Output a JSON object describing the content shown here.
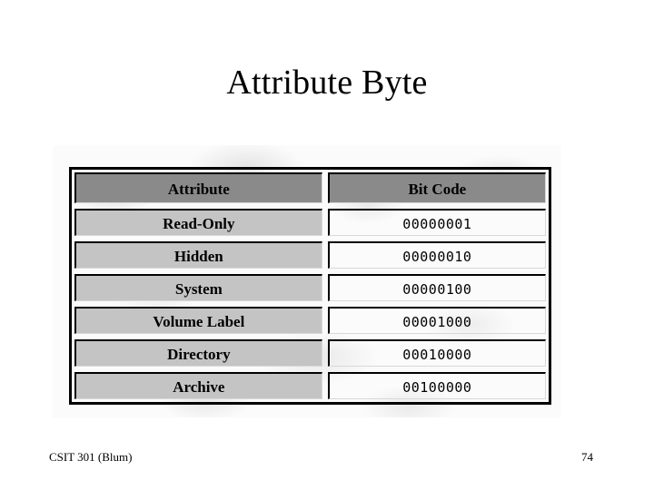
{
  "slide": {
    "title": "Attribute Byte",
    "page_number": "74",
    "course_footer": "CSIT 301 (Blum)"
  },
  "colors": {
    "header_cell": "#8a8a8a",
    "attribute_cell": "#c4c4c4",
    "code_cell": "#ffffff",
    "frame": "#000000",
    "figure_background": "#fbfbfb"
  },
  "table": {
    "columns": [
      "Attribute",
      "Bit Code"
    ],
    "rows": [
      {
        "attribute": "Read-Only",
        "bit_code": "00000001"
      },
      {
        "attribute": "Hidden",
        "bit_code": "00000010"
      },
      {
        "attribute": "System",
        "bit_code": "00000100"
      },
      {
        "attribute": "Volume Label",
        "bit_code": "00001000"
      },
      {
        "attribute": "Directory",
        "bit_code": "00010000"
      },
      {
        "attribute": "Archive",
        "bit_code": "00100000"
      }
    ]
  }
}
